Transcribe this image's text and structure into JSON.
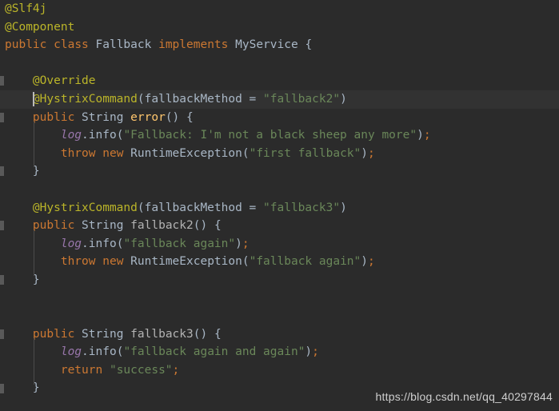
{
  "editor": {
    "language": "Java",
    "theme": "Darcula",
    "background_color": "#2b2b2b",
    "current_line_color": "#323232",
    "caret_line_index": 5,
    "colors": {
      "annotation": "#bbb529",
      "keyword": "#cc7832",
      "string": "#6a8759",
      "field": "#9876aa",
      "default_text": "#a9b7c6",
      "method_declaration": "#b3b3b3",
      "overridden_method": "#ffc66d",
      "gutter_marker": "#595959",
      "indent_guide": "#4b4b4b"
    },
    "lines": [
      {
        "indent": 0,
        "tokens": [
          {
            "t": "ann",
            "v": "@Slf4j"
          }
        ]
      },
      {
        "indent": 0,
        "tokens": [
          {
            "t": "ann",
            "v": "@Component"
          }
        ]
      },
      {
        "indent": 0,
        "tokens": [
          {
            "t": "kw",
            "v": "public"
          },
          {
            "t": "plain",
            "v": " "
          },
          {
            "t": "kw",
            "v": "class"
          },
          {
            "t": "plain",
            "v": " "
          },
          {
            "t": "type",
            "v": "Fallback"
          },
          {
            "t": "plain",
            "v": " "
          },
          {
            "t": "kw",
            "v": "implements"
          },
          {
            "t": "plain",
            "v": " "
          },
          {
            "t": "type",
            "v": "MyService"
          },
          {
            "t": "plain",
            "v": " {"
          }
        ]
      },
      {
        "indent": 0,
        "tokens": []
      },
      {
        "indent": 1,
        "marker": true,
        "tokens": [
          {
            "t": "ann",
            "v": "@Override"
          }
        ]
      },
      {
        "indent": 1,
        "marker": true,
        "current": true,
        "caret": true,
        "tokens": [
          {
            "t": "ann",
            "v": "@HystrixCommand"
          },
          {
            "t": "paren",
            "v": "("
          },
          {
            "t": "param",
            "v": "fallbackMethod"
          },
          {
            "t": "plain",
            "v": " = "
          },
          {
            "t": "str",
            "v": "\"fallback2\""
          },
          {
            "t": "paren",
            "v": ")"
          }
        ]
      },
      {
        "indent": 1,
        "marker": true,
        "tokens": [
          {
            "t": "kw",
            "v": "public"
          },
          {
            "t": "plain",
            "v": " "
          },
          {
            "t": "type",
            "v": "String"
          },
          {
            "t": "plain",
            "v": " "
          },
          {
            "t": "mover",
            "v": "error"
          },
          {
            "t": "paren",
            "v": "()"
          },
          {
            "t": "plain",
            "v": " {"
          }
        ]
      },
      {
        "indent": 2,
        "guide": true,
        "tokens": [
          {
            "t": "field",
            "v": "log"
          },
          {
            "t": "method",
            "v": ".info"
          },
          {
            "t": "paren",
            "v": "("
          },
          {
            "t": "str",
            "v": "\"Fallback: I'm not a black sheep any more\""
          },
          {
            "t": "paren",
            "v": ")"
          },
          {
            "t": "punc",
            "v": ";"
          }
        ]
      },
      {
        "indent": 2,
        "guide": true,
        "tokens": [
          {
            "t": "kw",
            "v": "throw"
          },
          {
            "t": "plain",
            "v": " "
          },
          {
            "t": "kw",
            "v": "new"
          },
          {
            "t": "plain",
            "v": " "
          },
          {
            "t": "type",
            "v": "RuntimeException"
          },
          {
            "t": "paren",
            "v": "("
          },
          {
            "t": "str",
            "v": "\"first fallback\""
          },
          {
            "t": "paren",
            "v": ")"
          },
          {
            "t": "punc",
            "v": ";"
          }
        ]
      },
      {
        "indent": 1,
        "marker": true,
        "tokens": [
          {
            "t": "plain",
            "v": "}"
          }
        ]
      },
      {
        "indent": 0,
        "tokens": []
      },
      {
        "indent": 1,
        "tokens": [
          {
            "t": "ann",
            "v": "@HystrixCommand"
          },
          {
            "t": "paren",
            "v": "("
          },
          {
            "t": "param",
            "v": "fallbackMethod"
          },
          {
            "t": "plain",
            "v": " = "
          },
          {
            "t": "str",
            "v": "\"fallback3\""
          },
          {
            "t": "paren",
            "v": ")"
          }
        ]
      },
      {
        "indent": 1,
        "marker": true,
        "tokens": [
          {
            "t": "kw",
            "v": "public"
          },
          {
            "t": "plain",
            "v": " "
          },
          {
            "t": "type",
            "v": "String"
          },
          {
            "t": "plain",
            "v": " "
          },
          {
            "t": "mdecl",
            "v": "fallback2"
          },
          {
            "t": "paren",
            "v": "()"
          },
          {
            "t": "plain",
            "v": " {"
          }
        ]
      },
      {
        "indent": 2,
        "guide": true,
        "tokens": [
          {
            "t": "field",
            "v": "log"
          },
          {
            "t": "method",
            "v": ".info"
          },
          {
            "t": "paren",
            "v": "("
          },
          {
            "t": "str",
            "v": "\"fallback again\""
          },
          {
            "t": "paren",
            "v": ")"
          },
          {
            "t": "punc",
            "v": ";"
          }
        ]
      },
      {
        "indent": 2,
        "guide": true,
        "tokens": [
          {
            "t": "kw",
            "v": "throw"
          },
          {
            "t": "plain",
            "v": " "
          },
          {
            "t": "kw",
            "v": "new"
          },
          {
            "t": "plain",
            "v": " "
          },
          {
            "t": "type",
            "v": "RuntimeException"
          },
          {
            "t": "paren",
            "v": "("
          },
          {
            "t": "str",
            "v": "\"fallback again\""
          },
          {
            "t": "paren",
            "v": ")"
          },
          {
            "t": "punc",
            "v": ";"
          }
        ]
      },
      {
        "indent": 1,
        "marker": true,
        "tokens": [
          {
            "t": "plain",
            "v": "}"
          }
        ]
      },
      {
        "indent": 0,
        "tokens": []
      },
      {
        "indent": 0,
        "tokens": []
      },
      {
        "indent": 1,
        "marker": true,
        "tokens": [
          {
            "t": "kw",
            "v": "public"
          },
          {
            "t": "plain",
            "v": " "
          },
          {
            "t": "type",
            "v": "String"
          },
          {
            "t": "plain",
            "v": " "
          },
          {
            "t": "mdecl",
            "v": "fallback3"
          },
          {
            "t": "paren",
            "v": "()"
          },
          {
            "t": "plain",
            "v": " {"
          }
        ]
      },
      {
        "indent": 2,
        "guide": true,
        "tokens": [
          {
            "t": "field",
            "v": "log"
          },
          {
            "t": "method",
            "v": ".info"
          },
          {
            "t": "paren",
            "v": "("
          },
          {
            "t": "str",
            "v": "\"fallback again and again\""
          },
          {
            "t": "paren",
            "v": ")"
          },
          {
            "t": "punc",
            "v": ";"
          }
        ]
      },
      {
        "indent": 2,
        "guide": true,
        "tokens": [
          {
            "t": "kw",
            "v": "return"
          },
          {
            "t": "plain",
            "v": " "
          },
          {
            "t": "str",
            "v": "\"success\""
          },
          {
            "t": "punc",
            "v": ";"
          }
        ]
      },
      {
        "indent": 1,
        "marker": true,
        "tokens": [
          {
            "t": "plain",
            "v": "}"
          }
        ]
      }
    ]
  },
  "watermark": {
    "text": "https://blog.csdn.net/qq_40297844"
  }
}
